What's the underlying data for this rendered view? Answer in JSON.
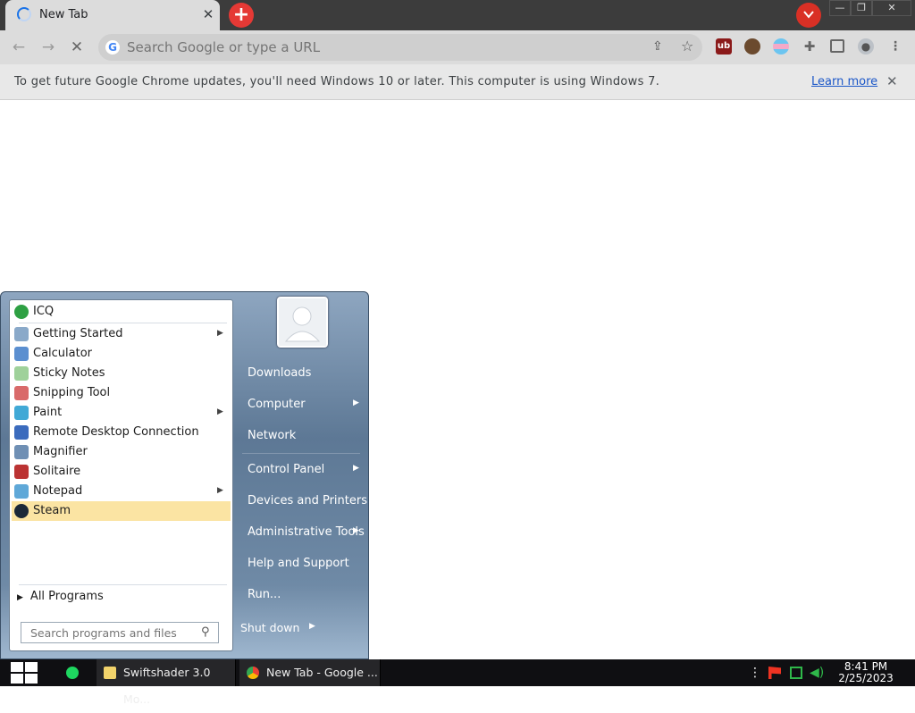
{
  "browser": {
    "tab_title": "New Tab",
    "tab_close": "✕",
    "new_tab": "+",
    "omnibox_placeholder": "Search Google or type a URL",
    "infobar_message": "To get future Google Chrome updates, you'll need Windows 10 or later. This computer is using Windows 7.",
    "infobar_link": "Learn more",
    "window_min": "—",
    "window_max": "❐",
    "window_close": "✕"
  },
  "start_menu": {
    "programs": [
      {
        "label": "ICQ",
        "icon": "icq-icon",
        "has_submenu": false
      },
      {
        "label": "Getting Started",
        "icon": "getting-started-icon",
        "has_submenu": true
      },
      {
        "label": "Calculator",
        "icon": "calculator-icon",
        "has_submenu": false
      },
      {
        "label": "Sticky Notes",
        "icon": "sticky-notes-icon",
        "has_submenu": false
      },
      {
        "label": "Snipping Tool",
        "icon": "snipping-tool-icon",
        "has_submenu": false
      },
      {
        "label": "Paint",
        "icon": "paint-icon",
        "has_submenu": true
      },
      {
        "label": "Remote Desktop Connection",
        "icon": "remote-desktop-icon",
        "has_submenu": false
      },
      {
        "label": "Magnifier",
        "icon": "magnifier-icon",
        "has_submenu": false
      },
      {
        "label": "Solitaire",
        "icon": "solitaire-icon",
        "has_submenu": false
      },
      {
        "label": "Notepad",
        "icon": "notepad-icon",
        "has_submenu": true
      },
      {
        "label": "Steam",
        "icon": "steam-icon",
        "has_submenu": false
      }
    ],
    "highlighted": "Steam",
    "all_programs": "All Programs",
    "search_placeholder": "Search programs and files",
    "right_links": [
      {
        "label": "Downloads",
        "has_submenu": false
      },
      {
        "label": "Computer",
        "has_submenu": true
      },
      {
        "label": "Network",
        "has_submenu": false
      },
      {
        "label": "Control Panel",
        "has_submenu": true
      },
      {
        "label": "Devices and Printers",
        "has_submenu": false
      },
      {
        "label": "Administrative Tools",
        "has_submenu": true
      },
      {
        "label": "Help and Support",
        "has_submenu": false
      },
      {
        "label": "Run...",
        "has_submenu": false
      }
    ],
    "shutdown": "Shut down"
  },
  "taskbar": {
    "items": [
      {
        "label": "Swiftshader 3.0 Mo...",
        "icon": "folder-icon"
      },
      {
        "label": "New Tab - Google ...",
        "icon": "chrome-icon"
      }
    ],
    "time": "8:41 PM",
    "date": "2/25/2023"
  },
  "colors": {
    "highlight": "#fbe4a3",
    "accent_red": "#e53935",
    "link_blue": "#1a56c8"
  }
}
